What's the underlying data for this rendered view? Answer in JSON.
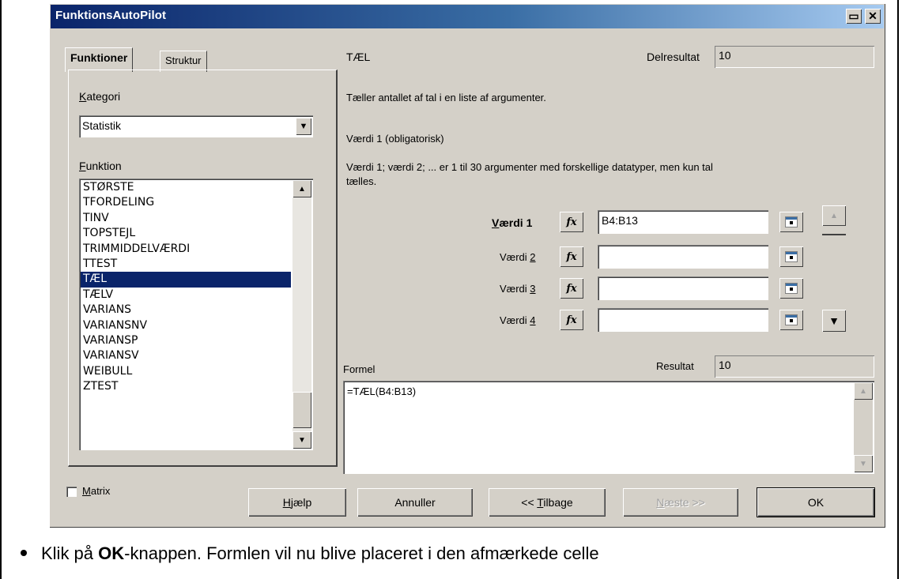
{
  "dialog": {
    "title": "FunktionsAutoPilot",
    "maximize_glyph": "▭",
    "close_glyph": "✕"
  },
  "tabs": [
    {
      "label": "Funktioner",
      "active": true
    },
    {
      "label": "Struktur",
      "active": false
    }
  ],
  "category": {
    "label_prefix": "",
    "label_underline": "K",
    "label_rest": "ategori",
    "value": "Statistik"
  },
  "function_list": {
    "label_underline": "F",
    "label_rest": "unktion",
    "items": [
      "STØRSTE",
      "TFORDELING",
      "TINV",
      "TOPSTEJL",
      "TRIMMIDDELVÆRDI",
      "TTEST",
      "TÆL",
      "TÆLV",
      "VARIANS",
      "VARIANSNV",
      "VARIANSP",
      "VARIANSV",
      "WEIBULL",
      "ZTEST"
    ],
    "selected_index": 6
  },
  "function_info": {
    "name": "TÆL",
    "partial_result_label": "Delresultat",
    "partial_result_value": "10",
    "description": "Tæller antallet af tal i en liste af argumenter.",
    "arg_title": "Værdi 1 (obligatorisk)",
    "arg_description_line1": "Værdi 1; værdi 2; ... er 1 til 30 argumenter med forskellige datatyper, men kun tal",
    "arg_description_line2": "tælles."
  },
  "arguments": [
    {
      "label_pre": "",
      "label_ul": "V",
      "label_post": "ærdi 1",
      "bold": true,
      "value": "B4:B13"
    },
    {
      "label_pre": "Værdi ",
      "label_ul": "2",
      "label_post": "",
      "bold": false,
      "value": ""
    },
    {
      "label_pre": "Værdi ",
      "label_ul": "3",
      "label_post": "",
      "bold": false,
      "value": ""
    },
    {
      "label_pre": "Værdi ",
      "label_ul": "4",
      "label_post": "",
      "bold": false,
      "value": ""
    }
  ],
  "fx_glyph": "fx",
  "formula": {
    "label": "Formel",
    "result_label": "Resultat",
    "result_value": "10",
    "value": "=TÆL(B4:B13)"
  },
  "matrix": {
    "label_ul": "M",
    "label_rest": "atrix",
    "checked": false
  },
  "buttons": {
    "help": {
      "ul": "H",
      "rest": "jælp"
    },
    "cancel": "Annuller",
    "back": {
      "pre": "<< ",
      "ul": "T",
      "rest": "ilbage"
    },
    "next": {
      "ul": "N",
      "rest": "æste >>"
    },
    "ok": "OK"
  },
  "scroll_glyphs": {
    "up": "▲",
    "down": "▼"
  },
  "instruction": {
    "pre": "Klik på ",
    "bold": "OK",
    "post": "-knappen. Formlen vil nu blive placeret i den afmærkede celle"
  }
}
